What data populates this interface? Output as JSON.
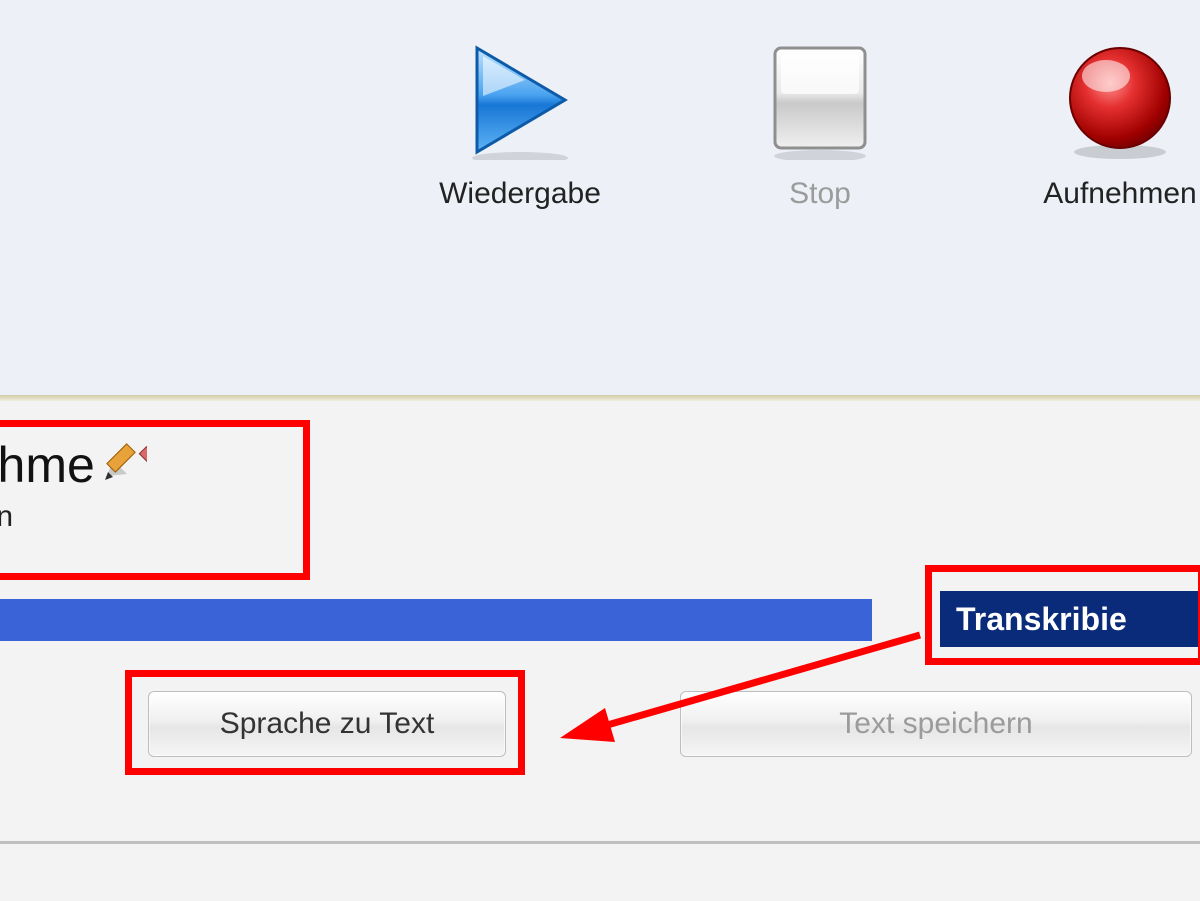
{
  "media": {
    "play": {
      "label": "Wiedergabe"
    },
    "stop": {
      "label": "Stop"
    },
    "record": {
      "label": "Aufnehmen"
    }
  },
  "recording": {
    "title_visible": "fnahme",
    "subtitle_visible": "rmann"
  },
  "buttons": {
    "transcribe": "Transkribie",
    "speech_to_text": "Sprache zu Text",
    "save_text": "Text speichern"
  },
  "colors": {
    "progress": "#3b63d8",
    "transcribe_bg": "#0a2a7a",
    "highlight": "#ff0000"
  }
}
